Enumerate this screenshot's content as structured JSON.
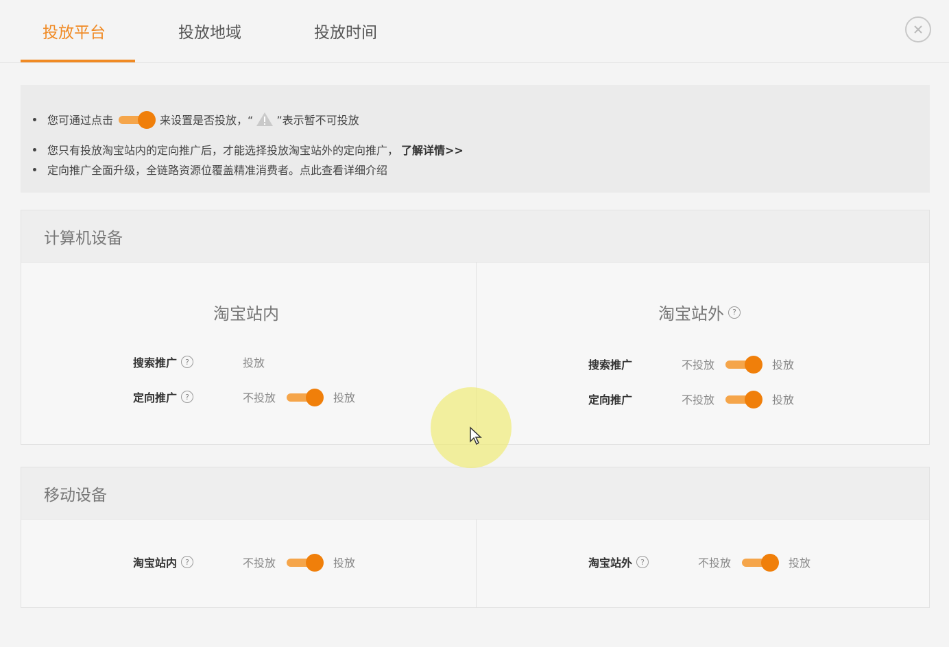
{
  "tabs": [
    {
      "label": "投放平台"
    },
    {
      "label": "投放地域"
    },
    {
      "label": "投放时间"
    }
  ],
  "notice": {
    "line1_prefix": "您可通过点击",
    "line1_middle": "来设置是否投放，“",
    "line1_suffix": "”表示暂不可投放",
    "line2": "您只有投放淘宝站内的定向推广后，才能选择投放淘宝站外的定向推广，",
    "line2_link": "了解详情>>",
    "line3": "定向推广全面升级，全链路资源位覆盖精准消费者。点此查看详细介绍"
  },
  "pc": {
    "title": "计算机设备",
    "inside": {
      "title": "淘宝站内",
      "rows": [
        {
          "label": "搜索推广",
          "status": "投放"
        },
        {
          "label": "定向推广",
          "off": "不投放",
          "on": "投放"
        }
      ]
    },
    "outside": {
      "title": "淘宝站外",
      "rows": [
        {
          "label": "搜索推广",
          "off": "不投放",
          "on": "投放"
        },
        {
          "label": "定向推广",
          "off": "不投放",
          "on": "投放"
        }
      ]
    }
  },
  "mobile": {
    "title": "移动设备",
    "inside": {
      "label": "淘宝站内",
      "off": "不投放",
      "on": "投放"
    },
    "outside": {
      "label": "淘宝站外",
      "off": "不投放",
      "on": "投放"
    }
  },
  "help_glyph": "?",
  "colors": {
    "accent": "#f08a24",
    "toggle_knob": "#f07f0a",
    "toggle_track": "#f5a54a"
  }
}
